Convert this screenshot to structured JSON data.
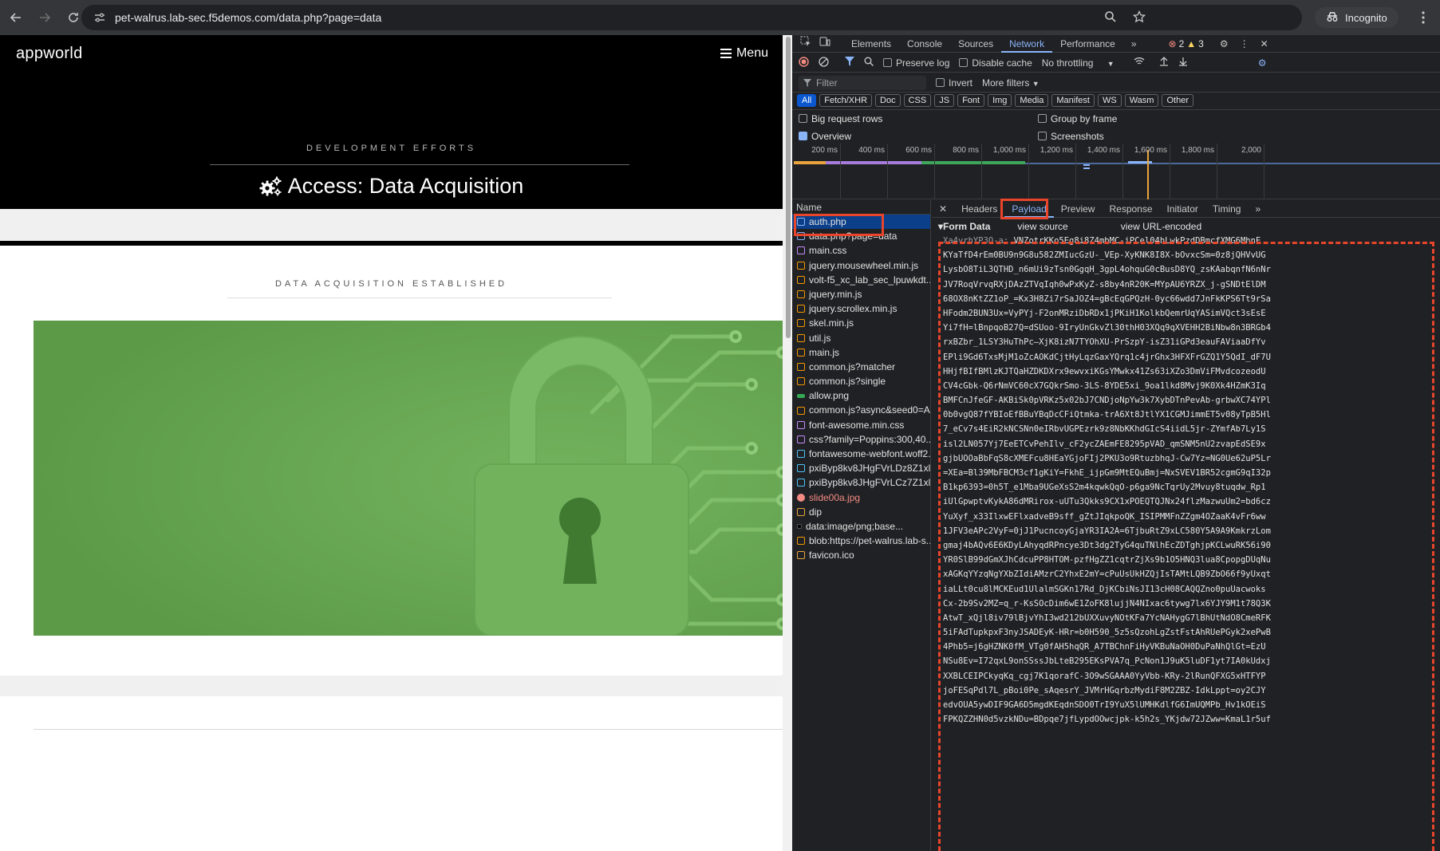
{
  "browser": {
    "url": "pet-walrus.lab-sec.f5demos.com/data.php?page=data",
    "incognito_label": "Incognito"
  },
  "site": {
    "logo": "appworld",
    "menu_label": "Menu",
    "banner_eyebrow": "DEVELOPMENT EFFORTS",
    "banner_title": "Access: Data Acquisition",
    "section_eyebrow": "DATA ACQUISITION ESTABLISHED"
  },
  "devtools": {
    "tabs": [
      "Elements",
      "Console",
      "Sources",
      "Network",
      "Performance"
    ],
    "active_tab": "Network",
    "error_count": "2",
    "warning_count": "3",
    "toolbar": {
      "preserve_log": "Preserve log",
      "disable_cache": "Disable cache",
      "throttling": "No throttling"
    },
    "filter": {
      "placeholder": "Filter",
      "invert": "Invert",
      "more_filters": "More filters"
    },
    "type_chips": [
      "All",
      "Fetch/XHR",
      "Doc",
      "CSS",
      "JS",
      "Font",
      "Img",
      "Media",
      "Manifest",
      "WS",
      "Wasm",
      "Other"
    ],
    "options": {
      "big_request_rows": "Big request rows",
      "group_by_frame": "Group by frame",
      "overview": "Overview",
      "screenshots": "Screenshots"
    },
    "timeline_ticks": [
      "200 ms",
      "400 ms",
      "600 ms",
      "800 ms",
      "1,000 ms",
      "1,200 ms",
      "1,400 ms",
      "1,600 ms",
      "1,800 ms",
      "2,000"
    ],
    "name_header": "Name",
    "requests": [
      {
        "name": "auth.php",
        "type": "doc"
      },
      {
        "name": "data.php?page=data",
        "type": "doc"
      },
      {
        "name": "main.css",
        "type": "css"
      },
      {
        "name": "jquery.mousewheel.min.js",
        "type": "js"
      },
      {
        "name": "volt-f5_xc_lab_sec_lpuwkdt...",
        "type": "js"
      },
      {
        "name": "jquery.min.js",
        "type": "js"
      },
      {
        "name": "jquery.scrollex.min.js",
        "type": "js"
      },
      {
        "name": "skel.min.js",
        "type": "js"
      },
      {
        "name": "util.js",
        "type": "js"
      },
      {
        "name": "main.js",
        "type": "js"
      },
      {
        "name": "common.js?matcher",
        "type": "js"
      },
      {
        "name": "common.js?single",
        "type": "js"
      },
      {
        "name": "allow.png",
        "type": "img"
      },
      {
        "name": "common.js?async&seed0=A...",
        "type": "js"
      },
      {
        "name": "font-awesome.min.css",
        "type": "css"
      },
      {
        "name": "css?family=Poppins:300,40...",
        "type": "css"
      },
      {
        "name": "fontawesome-webfont.woff2...",
        "type": "font"
      },
      {
        "name": "pxiByp8kv8JHgFVrLDz8Z1xl...",
        "type": "font"
      },
      {
        "name": "pxiByp8kv8JHgFVrLCz7Z1xl...",
        "type": "font"
      },
      {
        "name": "slide00a.jpg",
        "type": "error"
      },
      {
        "name": "dip",
        "type": "other"
      },
      {
        "name": "data:image/png;base...",
        "type": "data"
      },
      {
        "name": "blob:https://pet-walrus.lab-s...",
        "type": "js"
      },
      {
        "name": "favicon.ico",
        "type": "other"
      }
    ],
    "detail_tabs": [
      "Headers",
      "Payload",
      "Preview",
      "Response",
      "Initiator",
      "Timing"
    ],
    "detail_active_tab": "Payload",
    "payload": {
      "section_title": "Form Data",
      "view_source": "view source",
      "view_url_encoded": "view URL-encoded",
      "key": "Xa4vrhYP3Q-a:",
      "first_value": "VNZotrKKo5Eg8i8Z4mbMC-iPCel04hLwkPzdDBmcfXMG6MhnE",
      "lines": [
        "KYaTfD4rEm0BU9n9G8u582ZMIucGzU-_VEp-XyKNK8I8X-bOvxcSm=0z8jQHVvUG",
        "LysbO8TiL3QTHD_n6mUi9zTsn0GgqH_3gpL4ohquG0cBusD8YQ_zsKAabqnfN6nNr",
        "JV7RoqVrvqRXjDAzZTVqIqh0wPxKyZ-s8by4nR20K=MYpAU6YRZX_j-gSNDtElDM",
        "68OX8nKtZZ1oP_=Kx3H8Zi7rSaJOZ4=gBcEqGPQzH-0yc66wdd7JnFkKPS6Tt9rSa",
        "HFodm2BUN3Ux=VyPYj-F2onMRziDbRDx1jPKiH1KolkbQemrUqYASimVQct3sEsE",
        "Yi7fH=lBnpqoB27Q=dSUoo-9IryUnGkvZl30thH03XQq9qXVEHH2BiNbw8n3BRGb4",
        "rxBZbr_1LSY3HuThPc—XjK8izN7TYOhXU-PrSzpY-isZ31iGPd3eauFAViaaDfYv",
        "EPli9Gd6TxsMjM1oZcAOKdCjtHyLqzGaxYQrq1c4jrGhx3HFXFrGZQ1Y5QdI_dF7U",
        "HHjfBIfBMlzKJTQaHZDKDXrx9ewvxiKGsYMwkx41Zs63iXZo3DmViFMvdcozeodU",
        "CV4cGbk-Q6rNmVC60cX7GQkrSmo-3LS-8YDE5xi_9oa1lkd8Mvj9K0Xk4HZmK3Iq",
        "BMFCnJfeGF-AKBiSk0pVRKz5x02bJ7CNDjoNpYw3k7XybDTnPevAb-grbwXC74YPl",
        "0b0vgQ87fYBIoEfBBuYBqDcCFiQtmka-trA6Xt8JtlYX1CGMJimmET5v08yTpB5Hl",
        "7_eCv7s4EiR2kNCSNn0eIRbvUGPEzrk9z8NbKKhdGIcS4iidL5jr-ZYmfAb7Ly1S",
        "isl2LN057Yj7EeETCvPehIlv_cF2ycZAEmFE8295pVAD_qmSNM5nU2zvapEdSE9x",
        "gjbUOOaBbFqS8cXMEFcu8HEaYGjoFIj2PKU3o9RtuzbhqJ-Cw7Yz=NG0Ue62uP5Lr",
        "=XEa=Bl39MbFBCM3cf1gKiY=FkhE_ijpGm9MtEQuBmj=NxSVEV1BR52cgmG9qI32p",
        "B1kp6393=0h5T_e1Mba9UGeXsS2m4kqwkQqO-p6ga9NcTqrUy2Mvuy8tuqdw_Rp1",
        "iUlGpwptvKykA86dMRirox-uUTu3Qkks9CX1xPOEQTQJNx24flzMazwuUm2=bd6cz",
        "YuXyf_x33IlxwEFlxadveB9sff_gZtJIqkpoQK_ISIPMMFnZZgm4OZaaK4vFr6ww",
        "1JFV3eAPc2VyF=0jJ1PucncoyGjaYR3IA2A=6TjbuRtZ9xLC580Y5A9A9KmkrzLom",
        "gmaj4bAQv6E6KDyLAhyqdRPncye3Dt3dg2TyG4quTNlhEcZDTghjpKCLwuRK56i90",
        "YR0SlB99dGmXJhCdcuPP8HTOM-pzfHgZZ1cqtrZjXs9b1O5HNQ3lua8CpopgDUqNu",
        "xAGKqYYzqNgYXbZIdiAMzrC2YhxE2mY=cPuUsUkHZQjIsTAMtLQB9ZbO66f9yUxqt",
        "iaLLt0cu8lMCKEud1UlalmSGKn17Rd_DjKCbiNsJI13cH08CAQQZno0puUacwoks",
        "Cx-2b9Sv2MZ=q_r-KsSOcDim6wE1ZoFK8lujjN4NIxac6tywg7lx6YJY9M1t78Q3K",
        "AtwT_xQjl8iv79lBjvYhI3wd212bUXXuvyNOtKFa7YcNAHygG7lBhUtNdO8CmeRFK",
        "5iFAdTupkpxF3nyJSADEyK-HRr=b0H590_5z5sQzohLgZstFstAhRUePGyk2xePwB",
        "4Phb5=j6gHZNK0fM_VTg0fAH5hqQR_A7TBChnFiHyVKBuNaOH0DuPaNhQlGt=EzU",
        "NSu8Ev=I72qxL9onSSssJbLteB295EKsPVA7q_PcNon1J9uK5luDF1yt7IA0kUdxj",
        "XXBLCEIPCkyqKq_cgj7K1qorafC-3O9wSGAAA0YyVbb-KRy-2lRunQFXG5xHTFYP",
        "joFESqPdl7L_pBoi0Pe_sAqesrY_JVMrHGqrbzMydiF8M2ZBZ-IdkLppt=oy2CJY",
        "edvOUA5ywDIF9GA6D5mgdKEqdnSDO0TrI9YuX5lUMHKdlfG6ImUQMPb_Hv1kOEiS",
        "FPKQZZHN0d5vzkNDu=BDpqe7jfLypdOOwcjpk-k5h2s_YKjdw72JZww=KmaL1r5uf"
      ]
    },
    "colors": {
      "accent": "#8ab4f8",
      "highlight": "#e8452b"
    }
  }
}
